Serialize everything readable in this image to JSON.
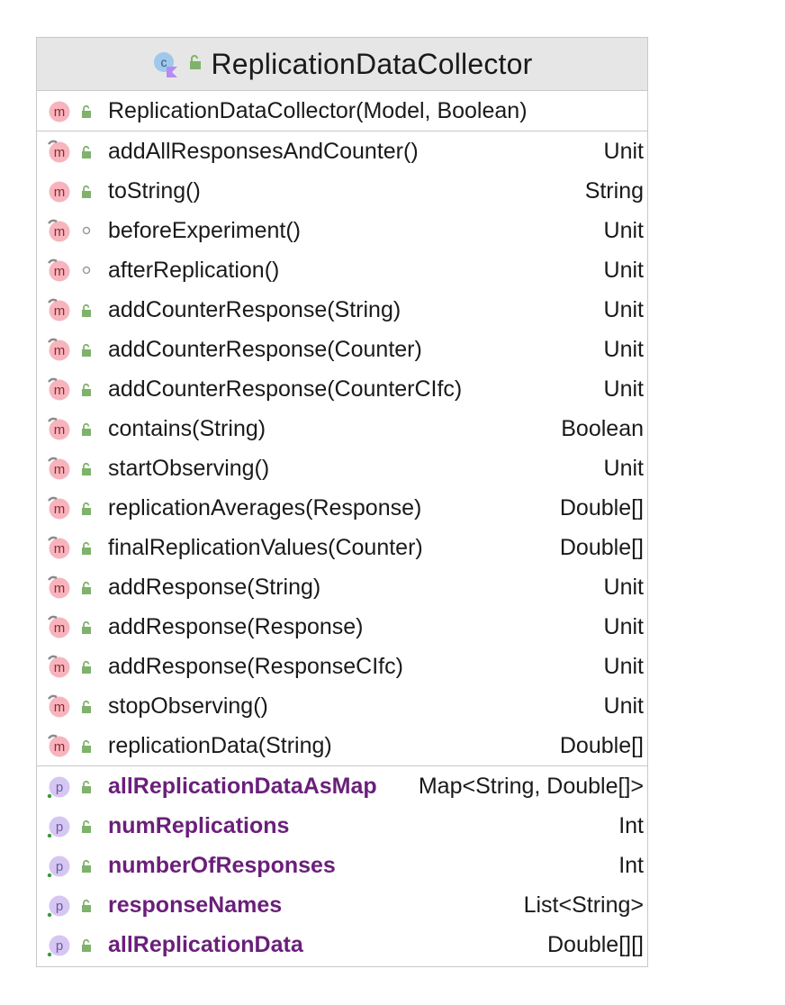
{
  "class_name": "ReplicationDataCollector",
  "colors": {
    "method_icon": "#f7b4bd",
    "property_icon": "#d6c6f2",
    "public_lock": "#7fb26b",
    "property_text": "#6a1f7a"
  },
  "constructor": {
    "signature": "ReplicationDataCollector(Model, Boolean)",
    "kind": "m",
    "visibility": "public"
  },
  "methods": [
    {
      "name": "addAllResponsesAndCounter()",
      "type": "Unit",
      "visibility": "public"
    },
    {
      "name": "toString()",
      "type": "String",
      "visibility": "public"
    },
    {
      "name": "beforeExperiment()",
      "type": "Unit",
      "visibility": "protected"
    },
    {
      "name": "afterReplication()",
      "type": "Unit",
      "visibility": "protected"
    },
    {
      "name": "addCounterResponse(String)",
      "type": "Unit",
      "visibility": "public"
    },
    {
      "name": "addCounterResponse(Counter)",
      "type": "Unit",
      "visibility": "public"
    },
    {
      "name": "addCounterResponse(CounterCIfc)",
      "type": "Unit",
      "visibility": "public"
    },
    {
      "name": "contains(String)",
      "type": "Boolean",
      "visibility": "public"
    },
    {
      "name": "startObserving()",
      "type": "Unit",
      "visibility": "public"
    },
    {
      "name": "replicationAverages(Response)",
      "type": "Double[]",
      "visibility": "public"
    },
    {
      "name": "finalReplicationValues(Counter)",
      "type": "Double[]",
      "visibility": "public"
    },
    {
      "name": "addResponse(String)",
      "type": "Unit",
      "visibility": "public"
    },
    {
      "name": "addResponse(Response)",
      "type": "Unit",
      "visibility": "public"
    },
    {
      "name": "addResponse(ResponseCIfc)",
      "type": "Unit",
      "visibility": "public"
    },
    {
      "name": "stopObserving()",
      "type": "Unit",
      "visibility": "public"
    },
    {
      "name": "replicationData(String)",
      "type": "Double[]",
      "visibility": "public"
    }
  ],
  "properties": [
    {
      "name": "allReplicationDataAsMap",
      "type": "Map<String, Double[]>",
      "visibility": "public"
    },
    {
      "name": "numReplications",
      "type": "Int",
      "visibility": "public"
    },
    {
      "name": "numberOfResponses",
      "type": "Int",
      "visibility": "public"
    },
    {
      "name": "responseNames",
      "type": "List<String>",
      "visibility": "public"
    },
    {
      "name": "allReplicationData",
      "type": "Double[][]",
      "visibility": "public"
    }
  ],
  "icon_names": {
    "class": "kotlin-class-icon",
    "method": "method-icon",
    "property": "property-icon",
    "public": "public-lock-icon",
    "protected": "protected-dot-icon"
  }
}
